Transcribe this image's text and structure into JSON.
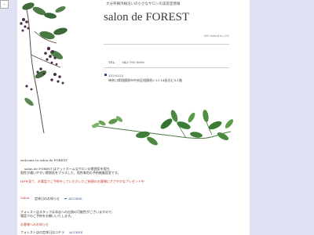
{
  "header": {
    "tagline": "大分県横浜線沿いの小さなサロンの美容室情報",
    "title": "salon de FOREST",
    "url": "999 dotted to_333"
  },
  "contact": {
    "tel_label": "TEL",
    "tel_value": "042-791-9999",
    "zip": "252-0223",
    "address": "神奈川県相模原市中央区相模原2-13-14長谷ビル1階"
  },
  "welcome": "welcome to salon de FOREST",
  "intro": {
    "line1": "salon de FOREST はアットホームなサロンの雰囲気を保ち",
    "line2": "男性が通いやすい雰囲気をプラスした、男性専用の予約制美容室です。",
    "line3": "HPを見て、お電話でご予約をしていただいたご新規のお客様にささやかなプレゼント中"
  },
  "news": {
    "label": "Salon",
    "text": "定休日のお知らせ",
    "link": "ACCESS"
  },
  "notice": {
    "line1": "フォレスト店スタッフは本店への出張の可能性がございますので、",
    "line2": "電話でのご予約をお願いいたします。"
  },
  "red_note": "お客様へのお知らせ",
  "guide": {
    "text": "フォレスト店の定休日はコチラ",
    "link": "ACCESS"
  },
  "icons": {
    "home": "home-icon",
    "decor": "plant-icon"
  }
}
